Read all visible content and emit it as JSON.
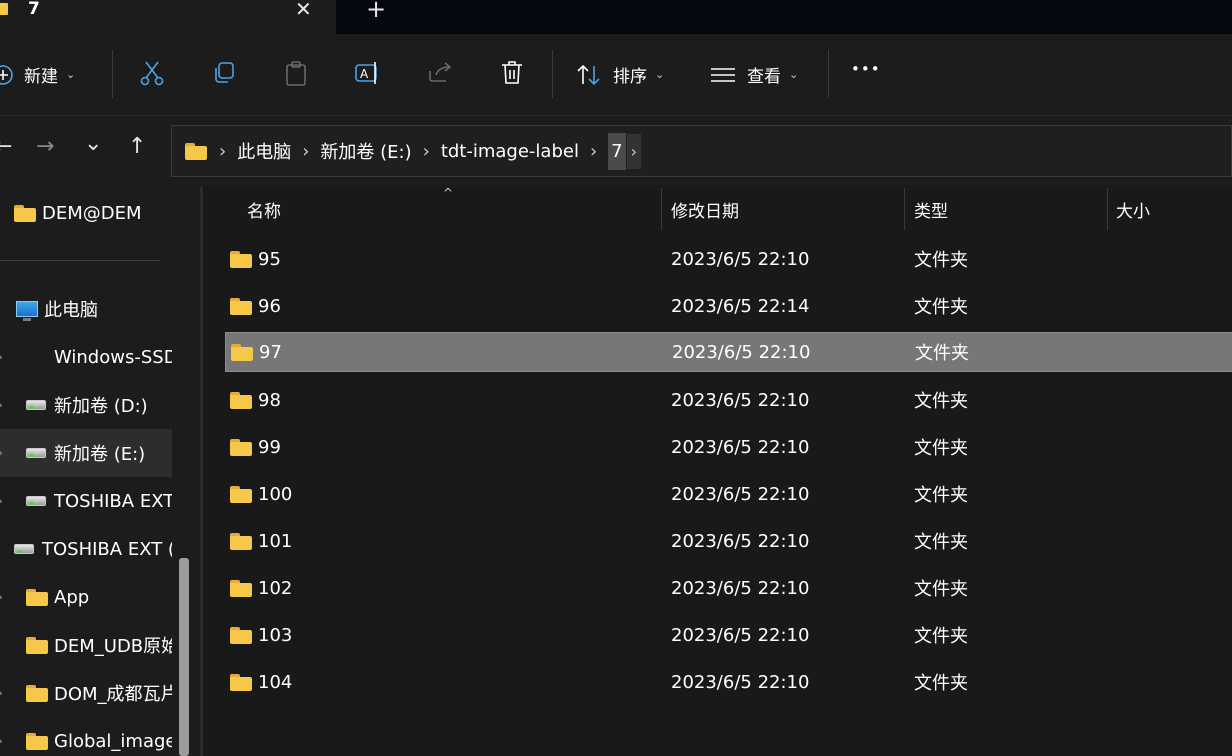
{
  "window": {
    "tab_title": "7",
    "close_glyph": "✕",
    "new_tab_glyph": "+"
  },
  "toolbar": {
    "new_label": "新建",
    "sort_label": "排序",
    "view_label": "查看",
    "more_glyph": "•••",
    "icons": [
      "add-circle-icon",
      "cut-icon",
      "copy-icon",
      "paste-icon",
      "rename-icon",
      "share-icon",
      "delete-icon",
      "sort-icon",
      "view-icon",
      "more-icon"
    ]
  },
  "nav": {
    "back_glyph": "←",
    "forward_glyph": "→",
    "recent_glyph": "⌄",
    "up_glyph": "↑"
  },
  "breadcrumb": {
    "items": [
      "此电脑",
      "新加卷 (E:)",
      "tdt-image-label",
      "7"
    ],
    "separator": "›"
  },
  "sidebar": {
    "items": [
      {
        "label": "DEM@DEM",
        "icon": "folder-icon"
      },
      {
        "label": "此电脑",
        "icon": "pc-icon"
      },
      {
        "label": "Windows-SSD",
        "icon": "drive-icon"
      },
      {
        "label": "新加卷 (D:)",
        "icon": "drive-icon"
      },
      {
        "label": "新加卷 (E:)",
        "icon": "drive-icon",
        "selected": true
      },
      {
        "label": "TOSHIBA EXT",
        "icon": "drive-icon"
      },
      {
        "label": "TOSHIBA EXT (",
        "icon": "drive-icon"
      },
      {
        "label": "App",
        "icon": "folder-icon"
      },
      {
        "label": "DEM_UDB原始",
        "icon": "folder-icon"
      },
      {
        "label": "DOM_成都瓦片",
        "icon": "folder-icon"
      },
      {
        "label": "Global_image",
        "icon": "folder-icon"
      }
    ],
    "expander_glyph": "›"
  },
  "columns": {
    "name": "名称",
    "date": "修改日期",
    "type": "类型",
    "size": "大小",
    "sort_glyph": "^"
  },
  "files": [
    {
      "name": "95",
      "date": "2023/6/5 22:10",
      "type": "文件夹"
    },
    {
      "name": "96",
      "date": "2023/6/5 22:14",
      "type": "文件夹"
    },
    {
      "name": "97",
      "date": "2023/6/5 22:10",
      "type": "文件夹",
      "selected": true
    },
    {
      "name": "98",
      "date": "2023/6/5 22:10",
      "type": "文件夹"
    },
    {
      "name": "99",
      "date": "2023/6/5 22:10",
      "type": "文件夹"
    },
    {
      "name": "100",
      "date": "2023/6/5 22:10",
      "type": "文件夹"
    },
    {
      "name": "101",
      "date": "2023/6/5 22:10",
      "type": "文件夹"
    },
    {
      "name": "102",
      "date": "2023/6/5 22:10",
      "type": "文件夹"
    },
    {
      "name": "103",
      "date": "2023/6/5 22:10",
      "type": "文件夹"
    },
    {
      "name": "104",
      "date": "2023/6/5 22:10",
      "type": "文件夹"
    }
  ]
}
